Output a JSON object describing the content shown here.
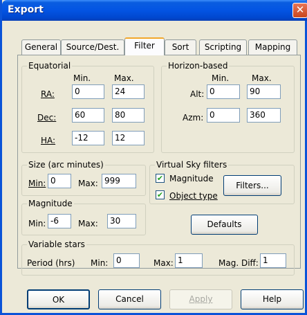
{
  "window": {
    "title": "Export",
    "close_glyph": "✕"
  },
  "tabs": [
    {
      "label": "General"
    },
    {
      "label": "Source/Dest."
    },
    {
      "label": "Filter"
    },
    {
      "label": "Sort"
    },
    {
      "label": "Scripting"
    },
    {
      "label": "Mapping"
    }
  ],
  "active_tab": "Filter",
  "equatorial": {
    "legend": "Equatorial",
    "min_header": "Min.",
    "max_header": "Max.",
    "rows": [
      {
        "label": "RA:",
        "min": "0",
        "max": "24"
      },
      {
        "label": "Dec:",
        "min": "60",
        "max": "80"
      },
      {
        "label": "HA:",
        "min": "-12",
        "max": "12"
      }
    ]
  },
  "horizon": {
    "legend": "Horizon-based",
    "min_header": "Min.",
    "max_header": "Max.",
    "rows": [
      {
        "label": "Alt:",
        "min": "0",
        "max": "90"
      },
      {
        "label": "Azm:",
        "min": "0",
        "max": "360"
      }
    ]
  },
  "size": {
    "legend": "Size (arc minutes)",
    "min_label": "Min:",
    "min_value": "0",
    "max_label": "Max:",
    "max_value": "999"
  },
  "magnitude": {
    "legend": "Magnitude",
    "min_label": "Min:",
    "min_value": "-6",
    "max_label": "Max:",
    "max_value": "30"
  },
  "virtual_sky": {
    "legend": "Virtual Sky filters",
    "magnitude_label": "Magnitude",
    "magnitude_checked": true,
    "object_type_label": "Object type",
    "object_type_checked": true,
    "filters_button": "Filters..."
  },
  "defaults_button": "Defaults",
  "variable_stars": {
    "legend": "Variable stars",
    "period_label": "Period (hrs)",
    "min_label": "Min:",
    "min_value": "0",
    "max_label": "Max:",
    "max_value": "1",
    "magdiff_label": "Mag. Diff:",
    "magdiff_value": "1"
  },
  "buttons": {
    "ok": "OK",
    "cancel": "Cancel",
    "apply": "Apply",
    "help": "Help"
  },
  "check_glyph": "✔"
}
